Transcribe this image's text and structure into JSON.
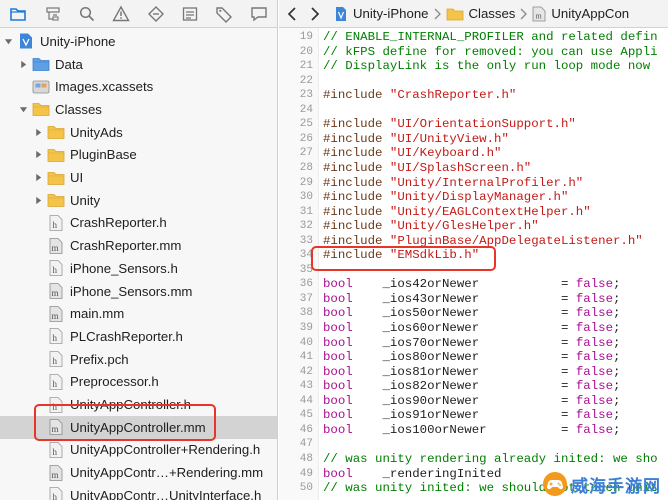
{
  "navigator": {
    "toolbar_icons": [
      "folder-icon",
      "hierarchy-icon",
      "magnifier-icon",
      "warning-icon",
      "diamond-icon",
      "list-icon",
      "tag-icon",
      "speech-icon"
    ],
    "items": [
      {
        "label": "Unity-iPhone",
        "kind": "project",
        "indent": 0,
        "disclosure": "open"
      },
      {
        "label": "Data",
        "kind": "folder-blue",
        "indent": 1,
        "disclosure": "closed"
      },
      {
        "label": "Images.xcassets",
        "kind": "assets",
        "indent": 1,
        "disclosure": "none"
      },
      {
        "label": "Classes",
        "kind": "folder",
        "indent": 1,
        "disclosure": "open"
      },
      {
        "label": "UnityAds",
        "kind": "folder",
        "indent": 2,
        "disclosure": "closed"
      },
      {
        "label": "PluginBase",
        "kind": "folder",
        "indent": 2,
        "disclosure": "closed"
      },
      {
        "label": "UI",
        "kind": "folder",
        "indent": 2,
        "disclosure": "closed"
      },
      {
        "label": "Unity",
        "kind": "folder",
        "indent": 2,
        "disclosure": "closed"
      },
      {
        "label": "CrashReporter.h",
        "kind": "h",
        "indent": 2,
        "disclosure": "none"
      },
      {
        "label": "CrashReporter.mm",
        "kind": "m",
        "indent": 2,
        "disclosure": "none"
      },
      {
        "label": "iPhone_Sensors.h",
        "kind": "h",
        "indent": 2,
        "disclosure": "none"
      },
      {
        "label": "iPhone_Sensors.mm",
        "kind": "m",
        "indent": 2,
        "disclosure": "none"
      },
      {
        "label": "main.mm",
        "kind": "m",
        "indent": 2,
        "disclosure": "none"
      },
      {
        "label": "PLCrashReporter.h",
        "kind": "h",
        "indent": 2,
        "disclosure": "none"
      },
      {
        "label": "Prefix.pch",
        "kind": "h",
        "indent": 2,
        "disclosure": "none"
      },
      {
        "label": "Preprocessor.h",
        "kind": "h",
        "indent": 2,
        "disclosure": "none"
      },
      {
        "label": "UnityAppController.h",
        "kind": "h",
        "indent": 2,
        "disclosure": "none"
      },
      {
        "label": "UnityAppController.mm",
        "kind": "m",
        "indent": 2,
        "disclosure": "none",
        "selected": true
      },
      {
        "label": "UnityAppController+Rendering.h",
        "kind": "h",
        "indent": 2,
        "disclosure": "none"
      },
      {
        "label": "UnityAppContr…+Rendering.mm",
        "kind": "m",
        "indent": 2,
        "disclosure": "none"
      },
      {
        "label": "UnityAppContr…UnityInterface.h",
        "kind": "h",
        "indent": 2,
        "disclosure": "none"
      }
    ]
  },
  "jump_bar": {
    "crumbs": [
      "Unity-iPhone",
      "Classes",
      "UnityAppCon"
    ]
  },
  "editor": {
    "lines": [
      {
        "n": "19",
        "tokens": [
          [
            "comment",
            "// ENABLE_INTERNAL_PROFILER and related defin"
          ]
        ]
      },
      {
        "n": "20",
        "tokens": [
          [
            "comment",
            "// kFPS define for removed: you can use Appli"
          ]
        ]
      },
      {
        "n": "21",
        "tokens": [
          [
            "comment",
            "// DisplayLink is the only run loop mode now"
          ]
        ]
      },
      {
        "n": "22",
        "tokens": []
      },
      {
        "n": "23",
        "tokens": [
          [
            "prep",
            "#include "
          ],
          [
            "str",
            "\"CrashReporter.h\""
          ]
        ]
      },
      {
        "n": "24",
        "tokens": []
      },
      {
        "n": "25",
        "tokens": [
          [
            "prep",
            "#include "
          ],
          [
            "str",
            "\"UI/OrientationSupport.h\""
          ]
        ]
      },
      {
        "n": "26",
        "tokens": [
          [
            "prep",
            "#include "
          ],
          [
            "str",
            "\"UI/UnityView.h\""
          ]
        ]
      },
      {
        "n": "27",
        "tokens": [
          [
            "prep",
            "#include "
          ],
          [
            "str",
            "\"UI/Keyboard.h\""
          ]
        ]
      },
      {
        "n": "28",
        "tokens": [
          [
            "prep",
            "#include "
          ],
          [
            "str",
            "\"UI/SplashScreen.h\""
          ]
        ]
      },
      {
        "n": "29",
        "tokens": [
          [
            "prep",
            "#include "
          ],
          [
            "str",
            "\"Unity/InternalProfiler.h\""
          ]
        ]
      },
      {
        "n": "30",
        "tokens": [
          [
            "prep",
            "#include "
          ],
          [
            "str",
            "\"Unity/DisplayManager.h\""
          ]
        ]
      },
      {
        "n": "31",
        "tokens": [
          [
            "prep",
            "#include "
          ],
          [
            "str",
            "\"Unity/EAGLContextHelper.h\""
          ]
        ]
      },
      {
        "n": "32",
        "tokens": [
          [
            "prep",
            "#include "
          ],
          [
            "str",
            "\"Unity/GlesHelper.h\""
          ]
        ]
      },
      {
        "n": "33",
        "tokens": [
          [
            "prep",
            "#include "
          ],
          [
            "str",
            "\"PluginBase/AppDelegateListener.h\""
          ]
        ]
      },
      {
        "n": "34",
        "tokens": [
          [
            "prep",
            "#include "
          ],
          [
            "str",
            "\"EMSdkLib.h\""
          ]
        ]
      },
      {
        "n": "35",
        "tokens": []
      },
      {
        "n": "36",
        "tokens": [
          [
            "kw",
            "bool"
          ],
          [
            "plain",
            "    _ios42orNewer           = "
          ],
          [
            "kw",
            "false"
          ],
          [
            "plain",
            ";"
          ]
        ]
      },
      {
        "n": "37",
        "tokens": [
          [
            "kw",
            "bool"
          ],
          [
            "plain",
            "    _ios43orNewer           = "
          ],
          [
            "kw",
            "false"
          ],
          [
            "plain",
            ";"
          ]
        ]
      },
      {
        "n": "38",
        "tokens": [
          [
            "kw",
            "bool"
          ],
          [
            "plain",
            "    _ios50orNewer           = "
          ],
          [
            "kw",
            "false"
          ],
          [
            "plain",
            ";"
          ]
        ]
      },
      {
        "n": "39",
        "tokens": [
          [
            "kw",
            "bool"
          ],
          [
            "plain",
            "    _ios60orNewer           = "
          ],
          [
            "kw",
            "false"
          ],
          [
            "plain",
            ";"
          ]
        ]
      },
      {
        "n": "40",
        "tokens": [
          [
            "kw",
            "bool"
          ],
          [
            "plain",
            "    _ios70orNewer           = "
          ],
          [
            "kw",
            "false"
          ],
          [
            "plain",
            ";"
          ]
        ]
      },
      {
        "n": "41",
        "tokens": [
          [
            "kw",
            "bool"
          ],
          [
            "plain",
            "    _ios80orNewer           = "
          ],
          [
            "kw",
            "false"
          ],
          [
            "plain",
            ";"
          ]
        ]
      },
      {
        "n": "42",
        "tokens": [
          [
            "kw",
            "bool"
          ],
          [
            "plain",
            "    _ios81orNewer           = "
          ],
          [
            "kw",
            "false"
          ],
          [
            "plain",
            ";"
          ]
        ]
      },
      {
        "n": "43",
        "tokens": [
          [
            "kw",
            "bool"
          ],
          [
            "plain",
            "    _ios82orNewer           = "
          ],
          [
            "kw",
            "false"
          ],
          [
            "plain",
            ";"
          ]
        ]
      },
      {
        "n": "44",
        "tokens": [
          [
            "kw",
            "bool"
          ],
          [
            "plain",
            "    _ios90orNewer           = "
          ],
          [
            "kw",
            "false"
          ],
          [
            "plain",
            ";"
          ]
        ]
      },
      {
        "n": "45",
        "tokens": [
          [
            "kw",
            "bool"
          ],
          [
            "plain",
            "    _ios91orNewer           = "
          ],
          [
            "kw",
            "false"
          ],
          [
            "plain",
            ";"
          ]
        ]
      },
      {
        "n": "46",
        "tokens": [
          [
            "kw",
            "bool"
          ],
          [
            "plain",
            "    _ios100orNewer          = "
          ],
          [
            "kw",
            "false"
          ],
          [
            "plain",
            ";"
          ]
        ]
      },
      {
        "n": "47",
        "tokens": []
      },
      {
        "n": "48",
        "tokens": [
          [
            "comment",
            "// was unity rendering already inited: we sho"
          ]
        ]
      },
      {
        "n": "49",
        "tokens": [
          [
            "kw",
            "bool"
          ],
          [
            "plain",
            "    _renderingInited"
          ]
        ]
      },
      {
        "n": "50",
        "tokens": [
          [
            "comment",
            "// was unity inited: we should not touch unit"
          ]
        ]
      }
    ]
  },
  "watermark": {
    "text": "威海手游网",
    "icon": "game-controller-logo-icon"
  },
  "colors": {
    "highlight": "#e8352a",
    "comment": "#007f00",
    "string": "#c41a16",
    "keyword": "#aa0d91",
    "preprocessor": "#6c3a1a",
    "folder": "#f4c449",
    "folder_blue": "#5e9fe6",
    "selection": "#d3d3d3"
  }
}
